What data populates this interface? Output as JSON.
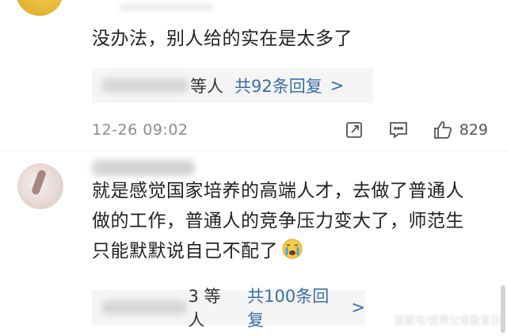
{
  "comments": [
    {
      "text": "没办法，别人给的实在是太多了",
      "replies": {
        "people_suffix": "等人",
        "count_text": "共92条回复",
        "chevron": ">"
      },
      "timestamp": "12-26 09:02",
      "like_count": "829"
    },
    {
      "text_line1": "就是感觉国家培养的高端人才，去做了普通人",
      "text_line2": "做的工作，普通人的竞争压力变大了，师范生",
      "text_line3": "只能默默说自己不配了",
      "replies": {
        "people_suffix": "3 等人",
        "count_text": "共100条回复",
        "chevron": ">"
      }
    }
  ],
  "watermark": "百家号/优秀父母教育日",
  "icons": {
    "share": "share-icon",
    "comment": "comment-icon",
    "like": "thumbs-up-icon",
    "emoji": "crying-face-emoji"
  },
  "colors": {
    "link": "#3b6ea8",
    "reply_bg": "#f5f5f5",
    "meta": "#8c8c8c"
  }
}
